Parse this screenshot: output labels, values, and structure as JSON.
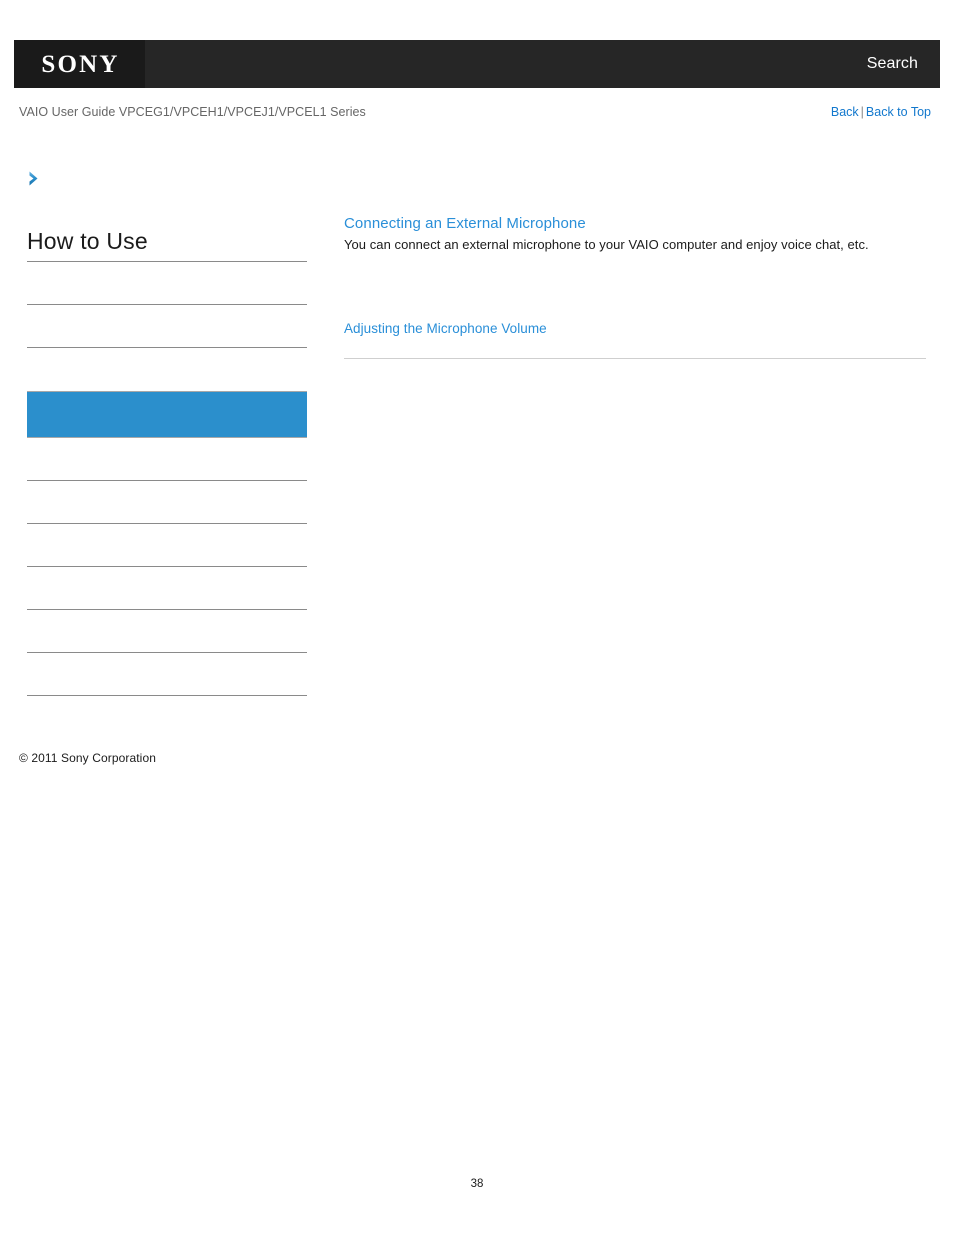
{
  "header": {
    "logo_text": "SONY",
    "logo_box_color": "#1a1a1a",
    "bar_color": "#262626",
    "search_label": "Search"
  },
  "subheader": {
    "guide_title": "VAIO User Guide VPCEG1/VPCEH1/VPCEJ1/VPCEL1 Series",
    "back_label": "Back",
    "separator": "|",
    "back_to_top_label": "Back to Top",
    "link_color": "#1278cd"
  },
  "sidebar": {
    "chevron_icon": "chevron-right-icon",
    "title": "How to Use",
    "selected_color": "#2b8fcc",
    "items": [
      {
        "label": "",
        "selected": false
      },
      {
        "label": "",
        "selected": false
      },
      {
        "label": "",
        "selected": false
      },
      {
        "label": "",
        "selected": true
      },
      {
        "label": "",
        "selected": false
      },
      {
        "label": "",
        "selected": false
      },
      {
        "label": "",
        "selected": false
      },
      {
        "label": "",
        "selected": false
      },
      {
        "label": "",
        "selected": false
      },
      {
        "label": "",
        "selected": false
      }
    ]
  },
  "content": {
    "topic_title": "Connecting an External Microphone",
    "topic_desc": "You can connect an external microphone to your VAIO computer and enjoy voice chat, etc.",
    "related_link": "Adjusting the Microphone Volume",
    "link_color": "#2a8fd8"
  },
  "footer": {
    "copyright": "© 2011 Sony Corporation",
    "page_number": "38"
  }
}
